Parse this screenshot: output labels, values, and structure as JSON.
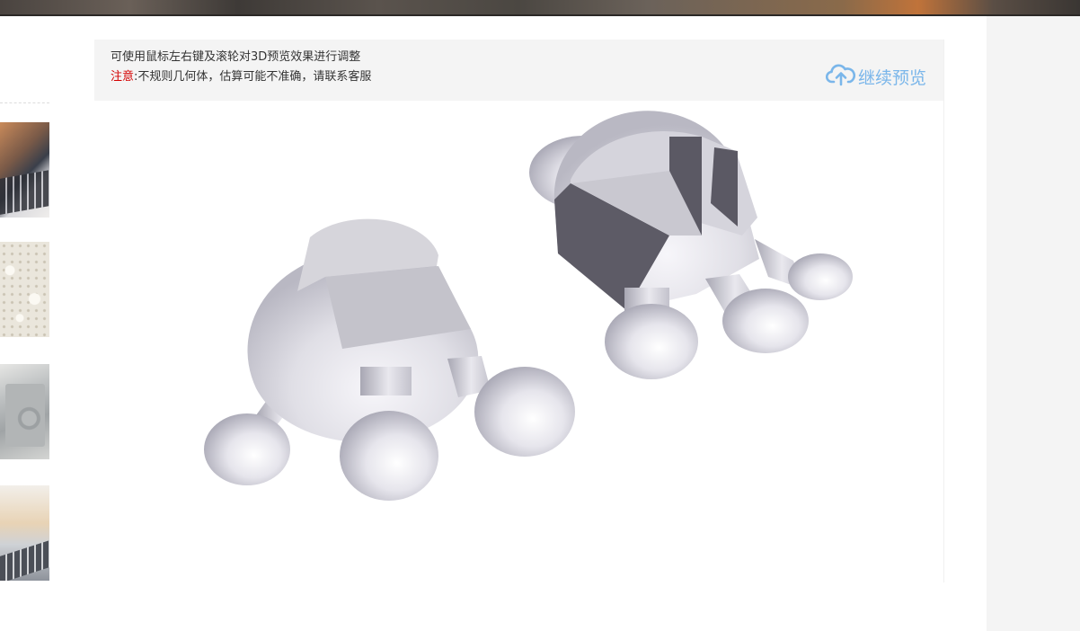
{
  "viewer": {
    "hint": "可使用鼠标左右键及滚轮对3D预览效果进行调整",
    "notice_label": "注意",
    "notice_text": ":不规则几何体，估算可能不准确，请联系客服",
    "continue_label": "继续预览"
  },
  "icons": {
    "continue": "cloud-upload-icon"
  },
  "colors": {
    "notice": "#d40000",
    "accent": "#7ab6ea",
    "info_bar": "#f4f4f4",
    "model_surface": "#e4e3e9",
    "model_shadow": "#5d5b66"
  }
}
